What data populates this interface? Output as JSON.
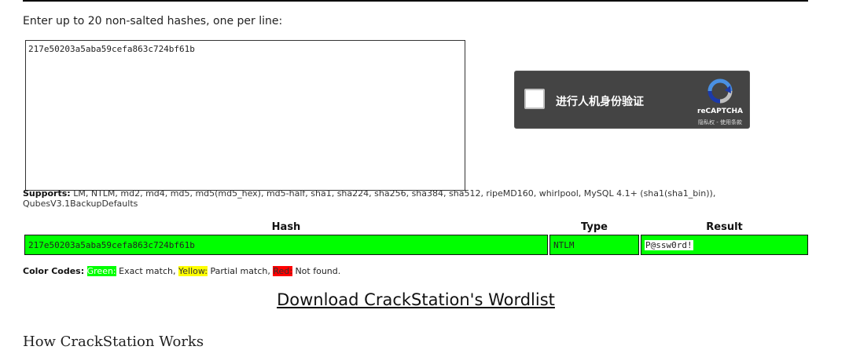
{
  "form": {
    "prompt": "Enter up to 20 non-salted hashes, one per line:",
    "hash_input_value": "217e50203a5aba59cefa863c724bf61b"
  },
  "recaptcha": {
    "label": "进行人机身份验证",
    "brand": "reCAPTCHA",
    "terms": "隐私权 - 使用条款",
    "icon": "recaptcha-logo-icon"
  },
  "supports": {
    "heading": "Supports:",
    "list": "LM, NTLM, md2, md4, md5, md5(md5_hex), md5-half, sha1, sha224, sha256, sha384, sha512, ripeMD160, whirlpool, MySQL 4.1+ (sha1(sha1_bin)), QubesV3.1BackupDefaults"
  },
  "results": {
    "headers": [
      "Hash",
      "Type",
      "Result"
    ],
    "rows": [
      {
        "hash": "217e50203a5aba59cefa863c724bf61b",
        "type": "NTLM",
        "result": "P@ssw0rd!",
        "status_color": "#00ff00"
      }
    ]
  },
  "color_codes": {
    "heading": "Color Codes:",
    "green": "Green:",
    "green_desc": "Exact match,",
    "yellow": "Yellow:",
    "yellow_desc": "Partial match,",
    "red": "Red:",
    "red_desc": "Not found."
  },
  "download_link": "Download CrackStation's Wordlist",
  "section_heading": "How CrackStation Works"
}
